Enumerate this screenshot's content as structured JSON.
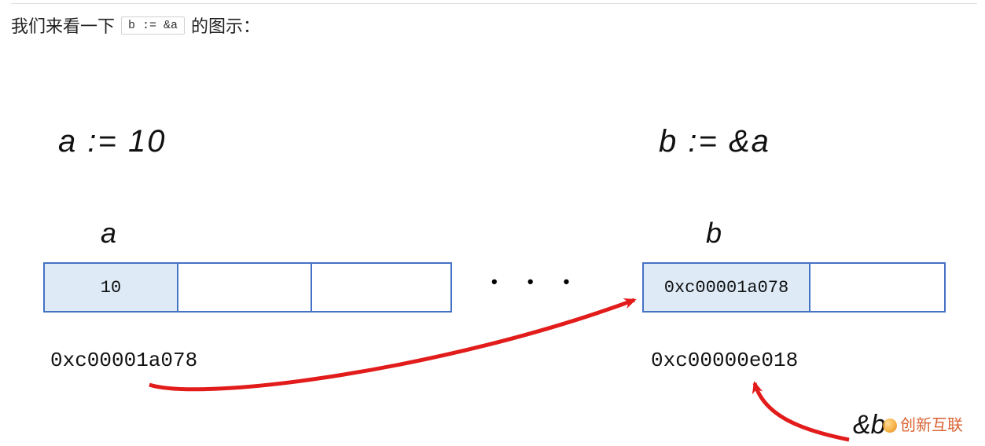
{
  "caption": {
    "before": "我们来看一下",
    "code": "b := &a",
    "after": "的图示："
  },
  "declarations": {
    "a": "a := 10",
    "b": "b := &a"
  },
  "labels": {
    "a": "a",
    "b": "b"
  },
  "cells": {
    "a": [
      "10",
      "",
      ""
    ],
    "b": [
      "0xc00001a078",
      ""
    ]
  },
  "dots": "• • •",
  "addresses": {
    "a": "0xc00001a078",
    "b": "0xc00000e018"
  },
  "amp_b": "&b",
  "watermark": "创新互联"
}
